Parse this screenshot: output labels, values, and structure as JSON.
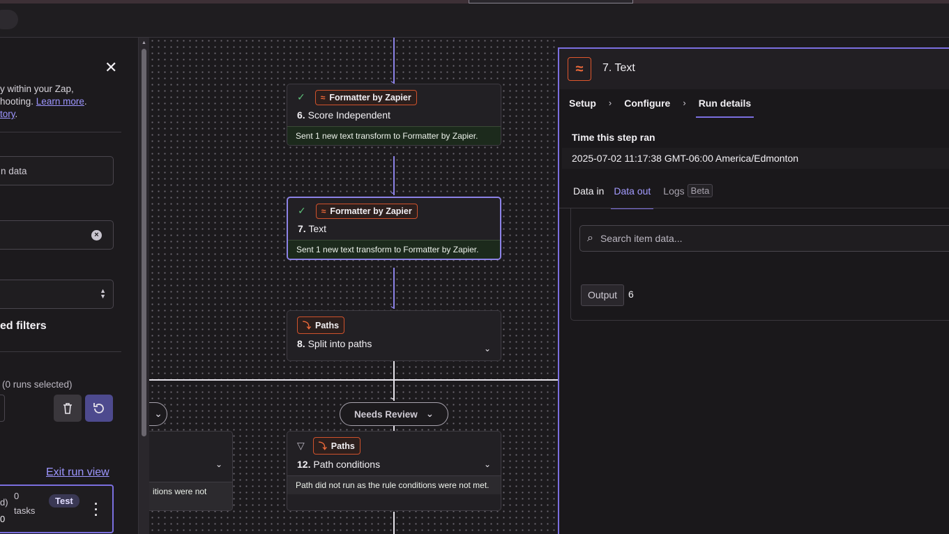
{
  "sidebar": {
    "text_line1": "y within your Zap,",
    "text_line2_pre": "hooting. ",
    "learn_more": "Learn more",
    "text_line2_post": ".",
    "text_line3_link": "tory",
    "text_line3_post": ".",
    "search_placeholder": "n data",
    "filters_title": "ed filters",
    "runs_selected": "(0 runs selected)",
    "exit_run_view": "Exit run view",
    "run_card": {
      "status_fragment": "d)",
      "count": "0",
      "tasks_label": "tasks",
      "badge": "Test",
      "zero_value": "0"
    }
  },
  "canvas": {
    "steps": [
      {
        "app": "Formatter by Zapier",
        "number": "6.",
        "title": "Score Independent",
        "message": "Sent 1 new text transform to Formatter by Zapier."
      },
      {
        "app": "Formatter by Zapier",
        "number": "7.",
        "title": "Text",
        "message": "Sent 1 new text transform to Formatter by Zapier."
      },
      {
        "app": "Paths",
        "number": "8.",
        "title": "Split into paths"
      },
      {
        "app": "Paths",
        "number": "12.",
        "title": "Path conditions",
        "message": "Path did not run as the rule conditions were not met."
      }
    ],
    "left_branch_message": "itions were not",
    "needs_review": "Needs Review"
  },
  "panel": {
    "title": "7. Text",
    "breadcrumbs": [
      "Setup",
      "Configure",
      "Run details"
    ],
    "time_label": "Time this step ran",
    "time_value": "2025-07-02 11:17:38 GMT-06:00 America/Edmonton",
    "tabs": {
      "data_in": "Data in",
      "data_out": "Data out",
      "logs": "Logs",
      "beta": "Beta"
    },
    "search_placeholder": "Search item data...",
    "output_key": "Output",
    "output_value": "6"
  },
  "colors": {
    "accent": "#7b6fe0",
    "formatter": "#e0572d",
    "success": "#5ec27a"
  }
}
